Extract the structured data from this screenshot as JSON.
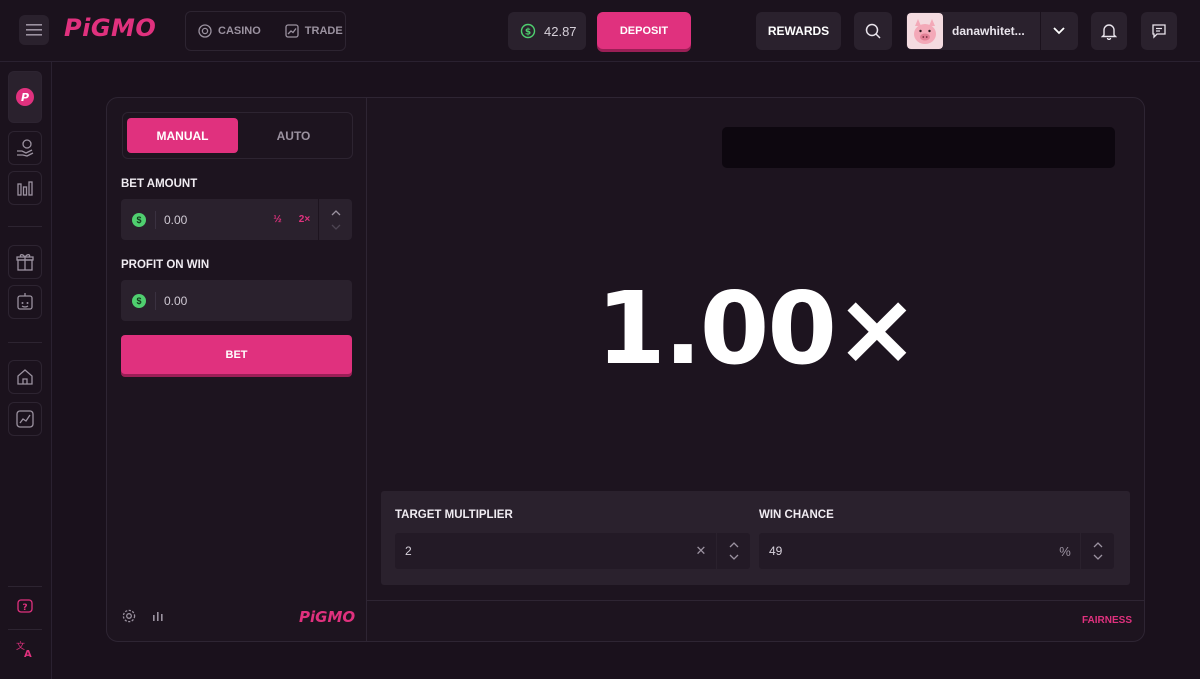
{
  "app": {
    "brand": "PiGMO"
  },
  "header": {
    "nav": [
      {
        "label": "CASINO",
        "icon": "casino-chip-icon"
      },
      {
        "label": "TRADE",
        "icon": "trend-icon"
      }
    ],
    "balance": "42.87",
    "deposit_label": "DEPOSIT",
    "rewards_label": "REWARDS",
    "username": "danawhitet..."
  },
  "sidebar": {
    "items": [
      "pigmo-icon",
      "hand-coin-icon",
      "bar-chart-icon",
      "gift-icon",
      "robot-icon",
      "home-icon",
      "trend-chart-icon",
      "help-icon",
      "translate-icon"
    ]
  },
  "controls": {
    "tabs": {
      "manual": "MANUAL",
      "auto": "AUTO"
    },
    "bet_amount": {
      "label": "BET AMOUNT",
      "value": "0.00",
      "half": "½",
      "double": "2×"
    },
    "profit_on_win": {
      "label": "PROFIT ON WIN",
      "value": "0.00"
    },
    "bet_label": "BET",
    "footer_brand": "PiGMO"
  },
  "board": {
    "multiplier": "1.00×",
    "target_multiplier": {
      "label": "TARGET MULTIPLIER",
      "value": "2",
      "suffix": "✕"
    },
    "win_chance": {
      "label": "WIN CHANCE",
      "value": "49",
      "suffix": "%"
    },
    "fairness_label": "FAIRNESS"
  },
  "colors": {
    "accent": "#e0317e",
    "background": "#1a111c",
    "panel": "#2a212d",
    "coin": "#4fcf6f"
  }
}
